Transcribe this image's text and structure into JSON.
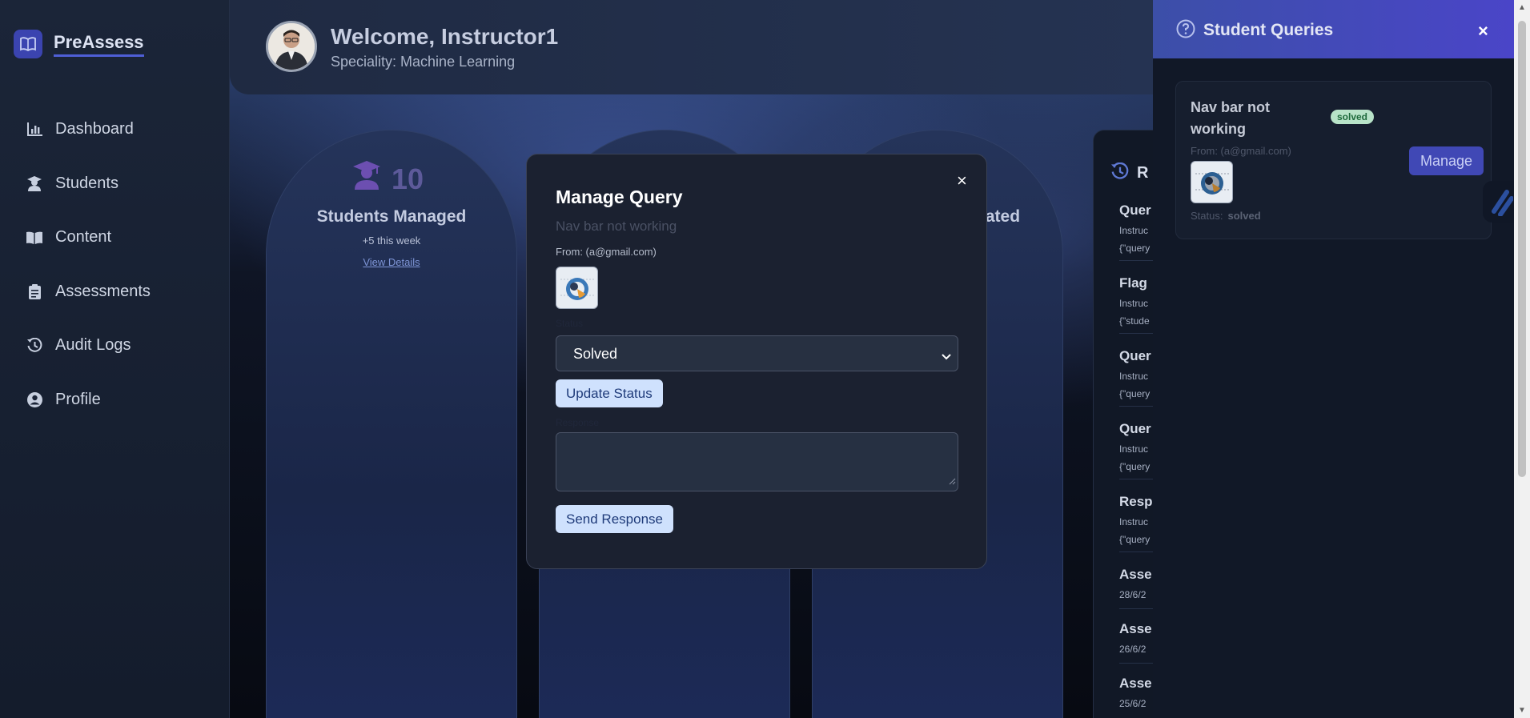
{
  "app": {
    "name": "PreAssess"
  },
  "sidebar": {
    "items": [
      {
        "label": "Dashboard",
        "icon": "chart-icon"
      },
      {
        "label": "Students",
        "icon": "student-icon"
      },
      {
        "label": "Content",
        "icon": "book-icon"
      },
      {
        "label": "Assessments",
        "icon": "clipboard-icon"
      },
      {
        "label": "Audit Logs",
        "icon": "history-icon"
      },
      {
        "label": "Profile",
        "icon": "user-circle-icon"
      }
    ]
  },
  "header": {
    "welcome": "Welcome, Instructor1",
    "speciality": "Speciality: Machine Learning"
  },
  "stats": {
    "students": {
      "count": "10",
      "title": "Students Managed",
      "sub": "+5 this week",
      "link": "View Details"
    },
    "third_partial": "erated"
  },
  "audit": {
    "heading_partial": "R",
    "entries": [
      {
        "title": "Quer",
        "line1": "Instruc",
        "line2": "{\"query"
      },
      {
        "title": "Flag",
        "line1": "Instruc",
        "line2": "{\"stude"
      },
      {
        "title": "Quer",
        "line1": "Instruc",
        "line2": "{\"query"
      },
      {
        "title": "Quer",
        "line1": "Instruc",
        "line2": "{\"query"
      },
      {
        "title": "Resp",
        "line1": "Instruc",
        "line2": "{\"query"
      },
      {
        "title": "Asse",
        "line1": "28/6/2",
        "line2": ""
      },
      {
        "title": "Asse",
        "line1": "26/6/2",
        "line2": ""
      },
      {
        "title": "Asse",
        "line1": "25/6/2",
        "line2": ""
      }
    ]
  },
  "modal": {
    "title": "Manage Query",
    "query": "Nav bar not working",
    "from": "From: (a@gmail.com)",
    "status_label": "Status",
    "status_value": "Solved",
    "update_button": "Update Status",
    "response_label": "Response",
    "response_value": "",
    "send_button": "Send Response",
    "close": "×"
  },
  "queries_panel": {
    "title": "Student Queries",
    "close": "×",
    "card": {
      "title": "Nav bar not working",
      "badge": "solved",
      "from": "From: (a@gmail.com)",
      "status_label": "Status:",
      "status_value": "solved",
      "manage": "Manage"
    }
  },
  "colors": {
    "accent": "#4048b5",
    "modal_button": "#cfe1fd",
    "badge_bg": "#b8e3c8",
    "panel_header": "#4a45c8"
  }
}
